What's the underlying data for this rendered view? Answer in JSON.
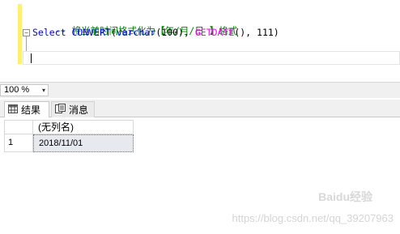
{
  "editor": {
    "line1": {
      "comment": "-- 将当前时间格式化为【年/月/日 】格式"
    },
    "line2": {
      "select": "Select",
      "convert": "CONVERT",
      "paren_open": "(",
      "varchar": "varchar",
      "arg1": "(100),",
      "getdate": "GETDATE",
      "arg2": "(),",
      "arg3": "111)"
    },
    "fold_symbol": "−"
  },
  "zoom": {
    "value": "100 %",
    "arrow": "▾"
  },
  "tabs": [
    {
      "label": "结果",
      "icon": "grid-icon"
    },
    {
      "label": "消息",
      "icon": "message-icon"
    }
  ],
  "grid": {
    "columns": [
      "(无列名)"
    ],
    "rows": [
      {
        "num": "1",
        "values": [
          "2018/11/01"
        ]
      }
    ]
  },
  "watermark": {
    "logo": "Baidu经验",
    "url": "https://blog.csdn.net/qq_39207963"
  },
  "colors": {
    "comment": "#008000",
    "keyword": "#0000ff",
    "function": "#ff00ff",
    "margin_marker": "#ffef72",
    "selected_cell": "#e6eaef"
  }
}
